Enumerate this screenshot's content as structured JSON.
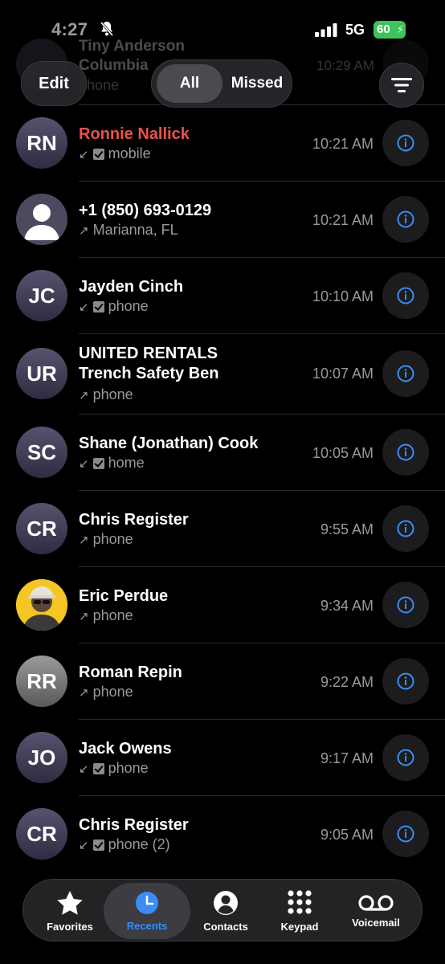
{
  "status": {
    "time": "4:27",
    "network": "5G",
    "battery": "60"
  },
  "header": {
    "edit_label": "Edit",
    "segments": [
      "All",
      "Missed"
    ],
    "selected": "All"
  },
  "ghost_row": {
    "name_line1": "Tiny Anderson",
    "name_line2": "Columbia",
    "type": "phone",
    "time": "10:29 AM"
  },
  "calls": [
    {
      "initials": "RN",
      "name": "Ronnie Nallick",
      "missed": true,
      "direction": "incoming",
      "type": "mobile",
      "time": "10:21 AM"
    },
    {
      "initials": "",
      "name": "+1 (850) 693-0129",
      "missed": false,
      "direction": "outgoing",
      "type": "Marianna, FL",
      "time": "10:21 AM"
    },
    {
      "initials": "JC",
      "name": "Jayden Cinch",
      "missed": false,
      "direction": "incoming",
      "type": "phone",
      "time": "10:10 AM"
    },
    {
      "initials": "UR",
      "name_line1": "UNITED RENTALS",
      "name_line2": "Trench Safety Ben",
      "missed": false,
      "direction": "outgoing",
      "type": "phone",
      "time": "10:07 AM"
    },
    {
      "initials": "SC",
      "name": "Shane (Jonathan) Cook",
      "missed": false,
      "direction": "incoming",
      "type": "home",
      "time": "10:05 AM"
    },
    {
      "initials": "CR",
      "name": "Chris Register",
      "missed": false,
      "direction": "outgoing",
      "type": "phone",
      "time": "9:55 AM"
    },
    {
      "initials": "",
      "name": "Eric Perdue",
      "missed": false,
      "direction": "outgoing",
      "type": "phone",
      "time": "9:34 AM"
    },
    {
      "initials": "RR",
      "name": "Roman Repin",
      "missed": false,
      "direction": "outgoing",
      "type": "phone",
      "time": "9:22 AM"
    },
    {
      "initials": "JO",
      "name": "Jack Owens",
      "missed": false,
      "direction": "incoming",
      "type": "phone",
      "time": "9:17 AM"
    },
    {
      "initials": "CR",
      "name": "Chris Register",
      "missed": false,
      "direction": "incoming",
      "type": "phone (2)",
      "time": "9:05 AM"
    }
  ],
  "tabs": [
    {
      "label": "Favorites",
      "icon": "star-icon"
    },
    {
      "label": "Recents",
      "icon": "clock-icon",
      "active": true
    },
    {
      "label": "Contacts",
      "icon": "person-circle-icon"
    },
    {
      "label": "Keypad",
      "icon": "keypad-icon"
    },
    {
      "label": "Voicemail",
      "icon": "voicemail-icon"
    }
  ],
  "colors": {
    "accent": "#3a8df5",
    "missed": "#e5534b",
    "battery": "#3cc45a"
  }
}
